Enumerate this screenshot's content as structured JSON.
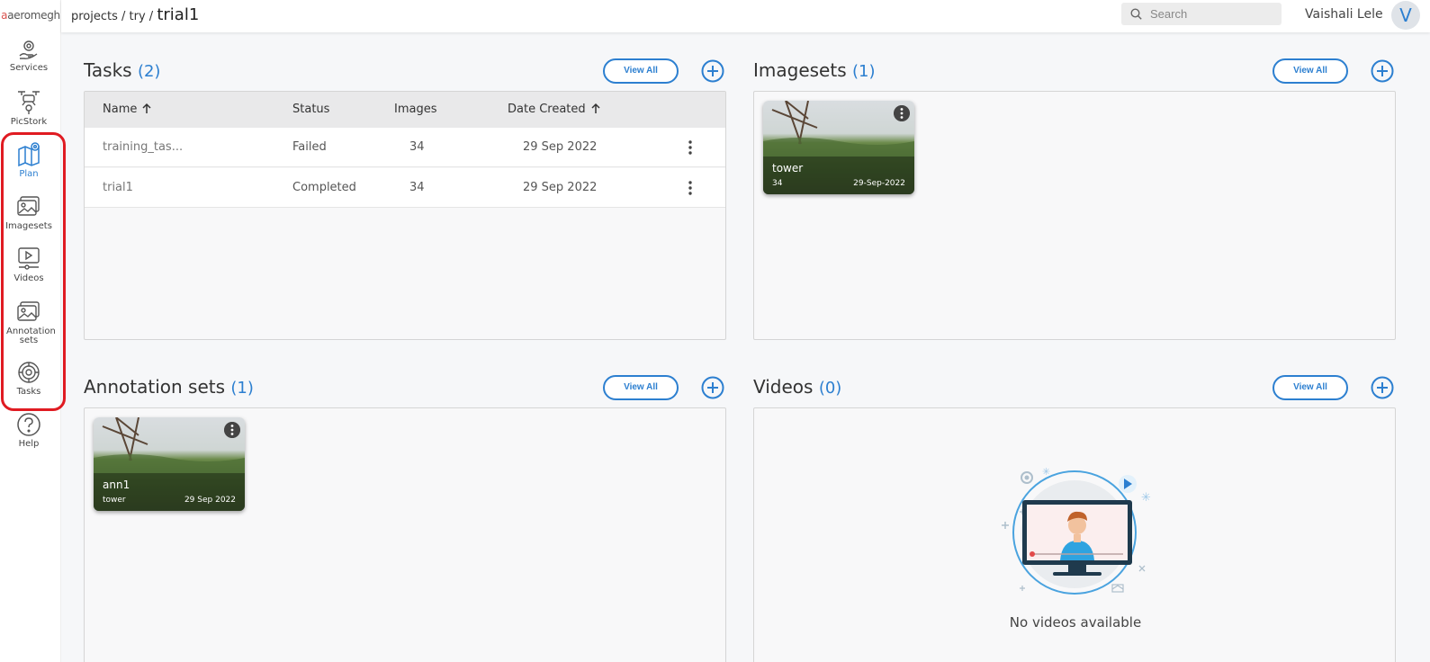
{
  "sidebar": {
    "logo": "aeromegh",
    "items": [
      {
        "label": "Services"
      },
      {
        "label": "PicStork"
      },
      {
        "label": "Plan"
      },
      {
        "label": "Imagesets"
      },
      {
        "label": "Videos"
      },
      {
        "label": "Annotation sets"
      },
      {
        "label": "Tasks"
      },
      {
        "label": "Help"
      }
    ]
  },
  "topbar": {
    "breadcrumb_path": "projects / try / ",
    "breadcrumb_current": "trial1",
    "search_placeholder": "Search",
    "username": "Vaishali Lele",
    "avatar_initial": "V"
  },
  "tasks": {
    "title": "Tasks",
    "count": "(2)",
    "view_all": "View All",
    "columns": [
      "Name",
      "Status",
      "Images",
      "Date Created"
    ],
    "rows": [
      {
        "name": "training_tas...",
        "status": "Failed",
        "images": "34",
        "date": "29 Sep 2022"
      },
      {
        "name": "trial1",
        "status": "Completed",
        "images": "34",
        "date": "29 Sep 2022"
      }
    ]
  },
  "imagesets": {
    "title": "Imagesets",
    "count": "(1)",
    "view_all": "View All",
    "cards": [
      {
        "title": "tower",
        "sub": "34",
        "date": "29-Sep-2022"
      }
    ]
  },
  "annotation_sets": {
    "title": "Annotation sets",
    "count": "(1)",
    "view_all": "View All",
    "cards": [
      {
        "title": "ann1",
        "sub": "tower",
        "date": "29 Sep 2022"
      }
    ]
  },
  "videos": {
    "title": "Videos",
    "count": "(0)",
    "view_all": "View All",
    "empty_text": "No videos available"
  },
  "colors": {
    "accent": "#2c7fd0",
    "highlight": "#e01b22"
  }
}
